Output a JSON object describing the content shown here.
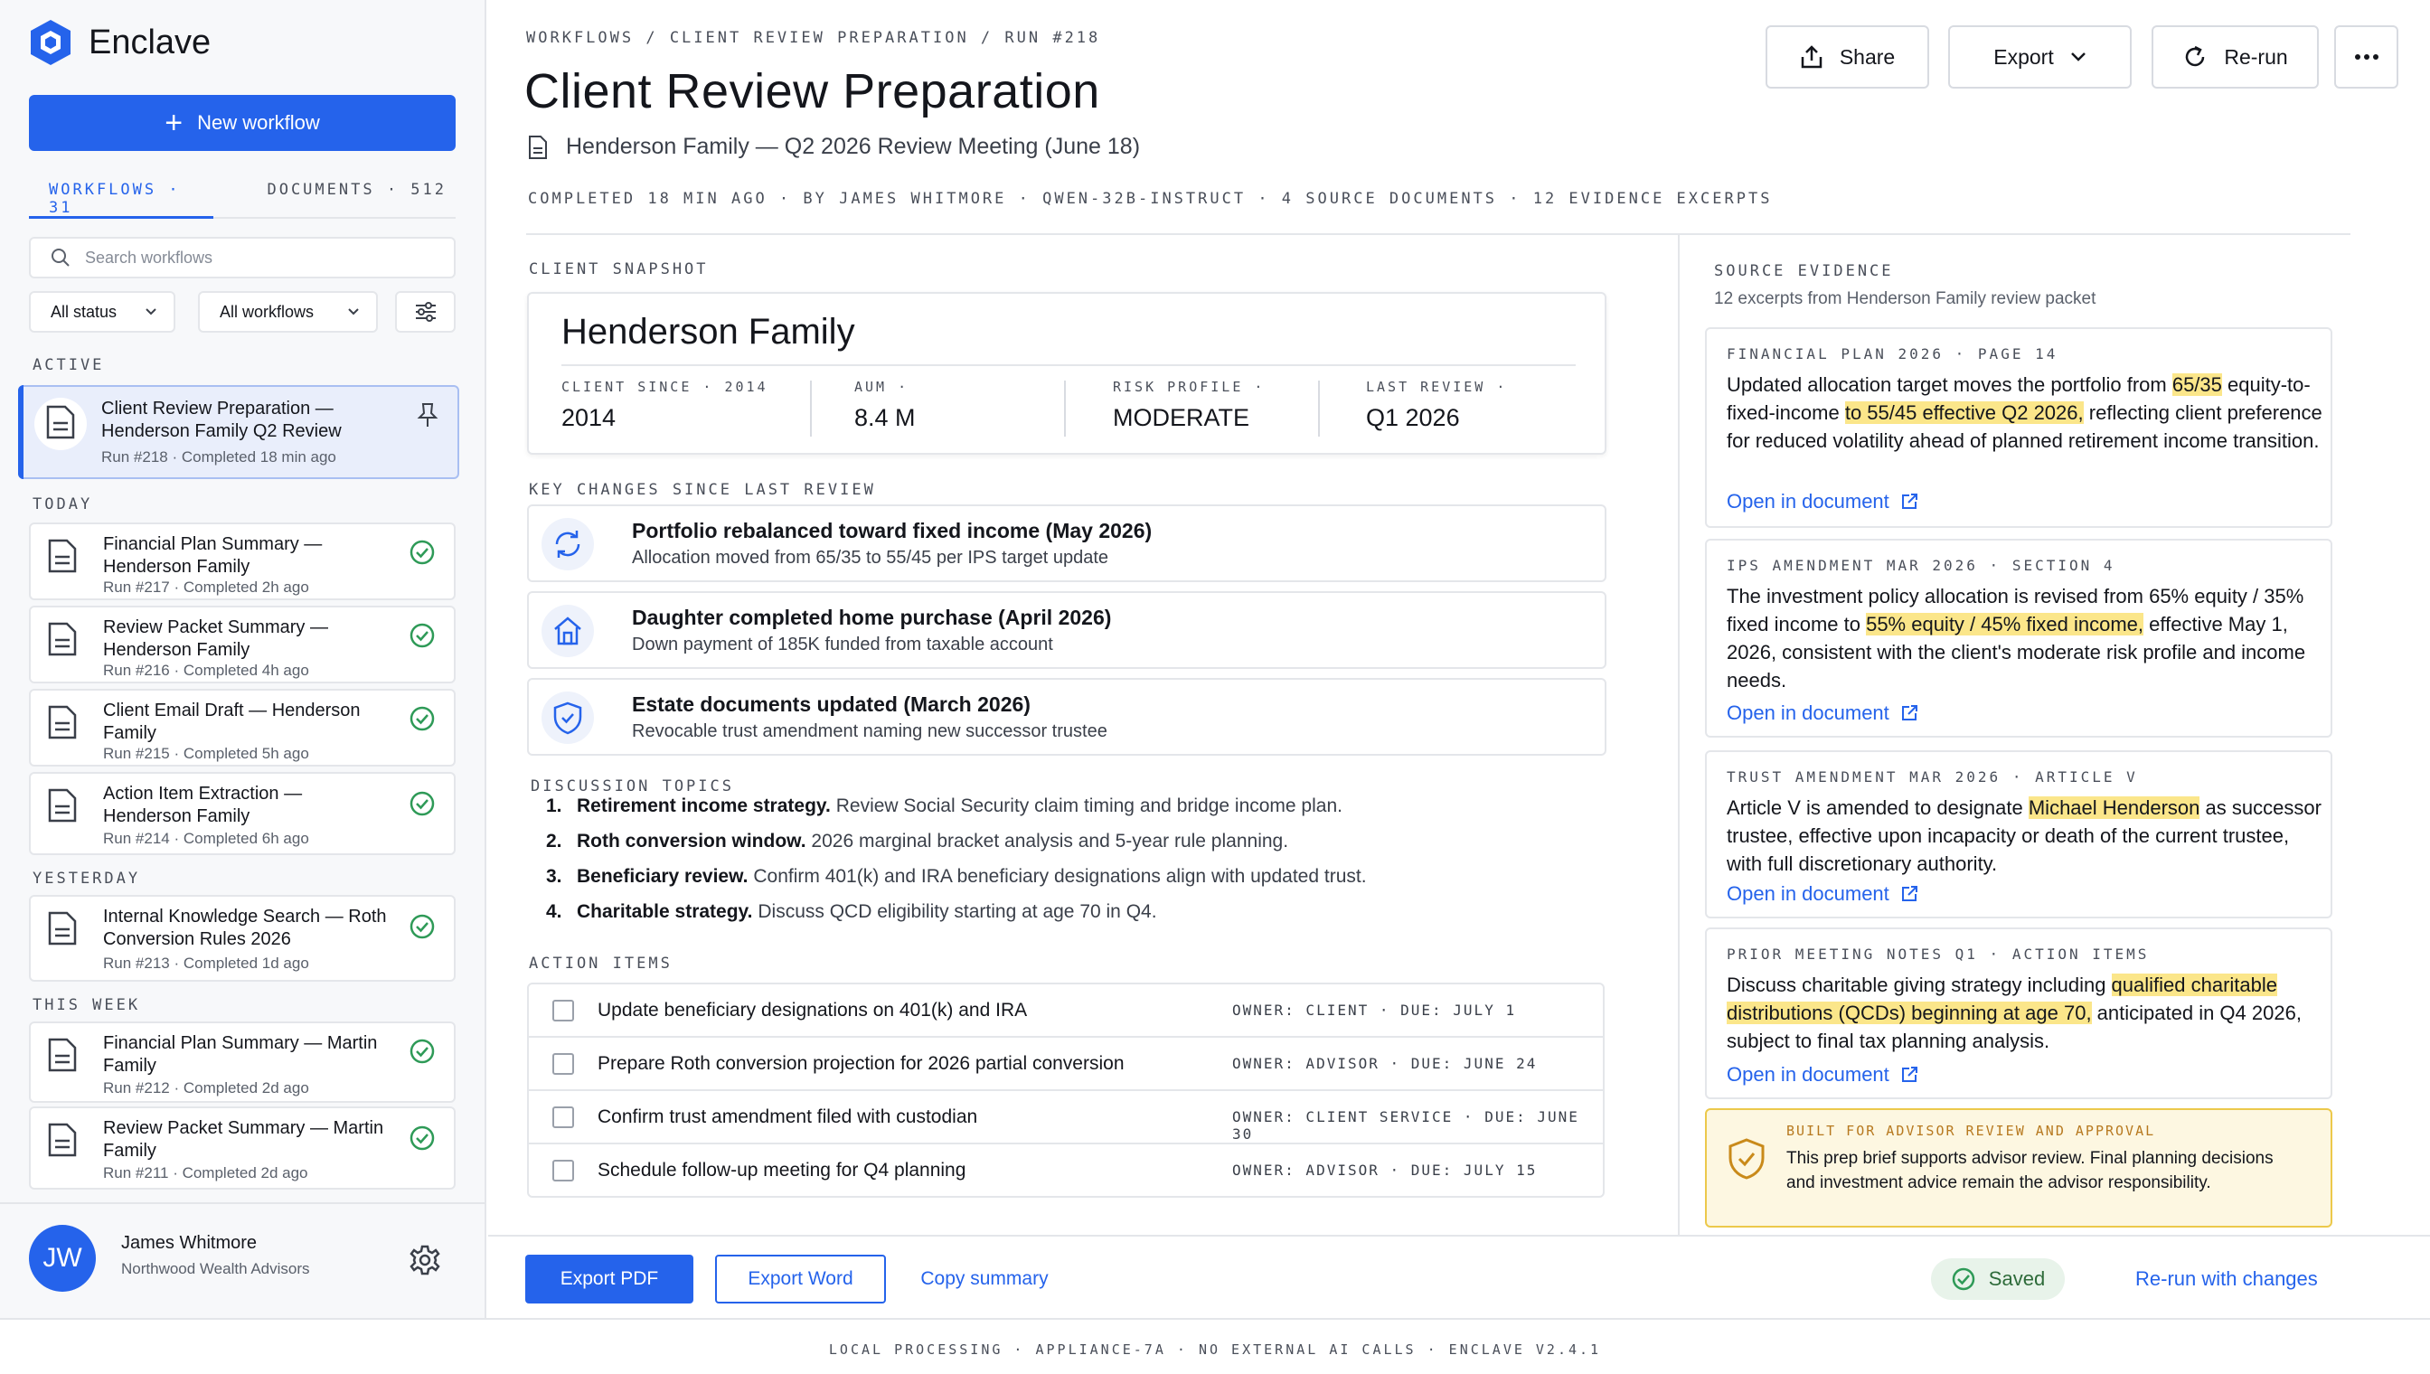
{
  "app": {
    "name": "Enclave",
    "brand_color": "#2563eb"
  },
  "sidebar": {
    "new_workflow_label": "New workflow",
    "tabs": [
      {
        "label": "WORKFLOWS · 31",
        "active": true
      },
      {
        "label": "DOCUMENTS · 512",
        "active": false
      }
    ],
    "search_placeholder": "Search workflows",
    "filters": {
      "status": "All status",
      "workflows": "All workflows"
    },
    "groups": {
      "active": "ACTIVE",
      "today": "TODAY",
      "yesterday": "YESTERDAY",
      "this_week": "THIS WEEK"
    },
    "items": [
      {
        "title": "Client Review Preparation — Henderson Family Q2 Review",
        "run": "Run #218",
        "completed": "Completed 18 min ago"
      },
      {
        "title": "Financial Plan Summary — Henderson Family",
        "run": "Run #217",
        "completed": "Completed 2h ago"
      },
      {
        "title": "Review Packet Summary — Henderson Family",
        "run": "Run #216",
        "completed": "Completed 4h ago"
      },
      {
        "title": "Client Email Draft — Henderson Family",
        "run": "Run #215",
        "completed": "Completed 5h ago"
      },
      {
        "title": "Action Item Extraction — Henderson Family",
        "run": "Run #214",
        "completed": "Completed 6h ago"
      },
      {
        "title": "Internal Knowledge Search — Roth Conversion Rules 2026",
        "run": "Run #213",
        "completed": "Completed 1d ago"
      },
      {
        "title": "Financial Plan Summary — Martin Family",
        "run": "Run #212",
        "completed": "Completed 2d ago"
      },
      {
        "title": "Review Packet Summary — Martin Family",
        "run": "Run #211",
        "completed": "Completed 2d ago"
      }
    ],
    "user": {
      "initials": "JW",
      "name": "James Whitmore",
      "org": "Northwood Wealth Advisors"
    }
  },
  "header": {
    "breadcrumb": "WORKFLOWS / CLIENT REVIEW PREPARATION / RUN #218",
    "title": "Client Review Preparation",
    "subtitle": "Henderson Family — Q2 2026 Review Meeting (June 18)",
    "meta": "COMPLETED 18 MIN AGO · BY JAMES WHITMORE · QWEN-32B-INSTRUCT · 4 SOURCE DOCUMENTS · 12 EVIDENCE EXCERPTS",
    "buttons": {
      "share": "Share",
      "export": "Export",
      "rerun": "Re-run"
    }
  },
  "snapshot": {
    "label": "CLIENT SNAPSHOT",
    "name": "Henderson Family",
    "fields": [
      {
        "key": "CLIENT SINCE · 2014",
        "value": "2014"
      },
      {
        "key": "AUM ·",
        "value": "8.4 M"
      },
      {
        "key": "RISK PROFILE ·",
        "value": "MODERATE"
      },
      {
        "key": "LAST REVIEW ·",
        "value": "Q1 2026"
      }
    ]
  },
  "changes": {
    "label": "KEY CHANGES SINCE LAST REVIEW",
    "items": [
      {
        "icon": "refresh-icon",
        "title": "Portfolio rebalanced toward fixed income (May 2026)",
        "desc": "Allocation moved from 65/35 to 55/45 per IPS target update"
      },
      {
        "icon": "home-icon",
        "title": "Daughter completed home purchase (April 2026)",
        "desc": "Down payment of 185K funded from taxable account"
      },
      {
        "icon": "shield-icon",
        "title": "Estate documents updated (March 2026)",
        "desc": "Revocable trust amendment naming new successor trustee"
      }
    ]
  },
  "topics": {
    "label": "DISCUSSION TOPICS",
    "items": [
      {
        "n": "1.",
        "bold": "Retirement income strategy.",
        "text": "Review Social Security claim timing and bridge income plan."
      },
      {
        "n": "2.",
        "bold": "Roth conversion window.",
        "text": "2026 marginal bracket analysis and 5-year rule planning."
      },
      {
        "n": "3.",
        "bold": "Beneficiary review.",
        "text": "Confirm 401(k) and IRA beneficiary designations align with updated trust."
      },
      {
        "n": "4.",
        "bold": "Charitable strategy.",
        "text": "Discuss QCD eligibility starting at age 70 in Q4."
      }
    ]
  },
  "actions": {
    "label": "ACTION ITEMS",
    "items": [
      {
        "text": "Update beneficiary designations on 401(k) and IRA",
        "owner": "OWNER: CLIENT · DUE: JULY 1",
        "checked": false
      },
      {
        "text": "Prepare Roth conversion projection for 2026 partial conversion",
        "owner": "OWNER: ADVISOR · DUE: JUNE 24",
        "checked": false
      },
      {
        "text": "Confirm trust amendment filed with custodian",
        "owner": "OWNER: CLIENT SERVICE · DUE: JUNE 30",
        "checked": false
      },
      {
        "text": "Schedule follow-up meeting for Q4 planning",
        "owner": "OWNER: ADVISOR · DUE: JULY 15",
        "checked": false
      }
    ]
  },
  "evidence": {
    "label": "SOURCE EVIDENCE",
    "subtitle": "12 excerpts from Henderson Family review packet",
    "link_label": "Open in document",
    "cards": [
      {
        "source": "FINANCIAL PLAN 2026 · PAGE 14",
        "parts": [
          "Updated allocation target moves the portfolio from ",
          "65/35",
          " equity-to-fixed-income ",
          "to 55/45 effective Q2 2026,",
          " reflecting client preference for reduced volatility ahead of planned retirement income transition."
        ]
      },
      {
        "source": "IPS AMENDMENT MAR 2026 · SECTION 4",
        "parts": [
          "The investment policy allocation is revised from 65% equity / 35% fixed income to ",
          "55% equity / 45% fixed income,",
          " effective May 1, 2026, consistent with the client's moderate risk profile and income needs."
        ]
      },
      {
        "source": "TRUST AMENDMENT MAR 2026 · ARTICLE V",
        "parts": [
          "Article V is amended to designate ",
          "Michael Henderson",
          " as successor trustee, effective upon incapacity or death of the current trustee, with full discretionary authority."
        ]
      },
      {
        "source": "PRIOR MEETING NOTES Q1 · ACTION ITEMS",
        "parts": [
          "Discuss charitable giving strategy including ",
          "qualified charitable distributions (QCDs) beginning at age 70,",
          " anticipated in Q4 2026, subject to final tax planning analysis."
        ]
      }
    ],
    "notice": {
      "title": "BUILT FOR ADVISOR REVIEW AND APPROVAL",
      "body": "This prep brief supports advisor review. Final planning decisions and investment advice remain the advisor responsibility."
    }
  },
  "bottom_bar": {
    "export_pdf": "Export PDF",
    "export_word": "Export Word",
    "copy_summary": "Copy summary",
    "saved": "Saved",
    "rerun_changes": "Re-run with changes"
  },
  "footer": "LOCAL PROCESSING · APPLIANCE-7A · NO EXTERNAL AI CALLS · ENCLAVE v2.4.1"
}
